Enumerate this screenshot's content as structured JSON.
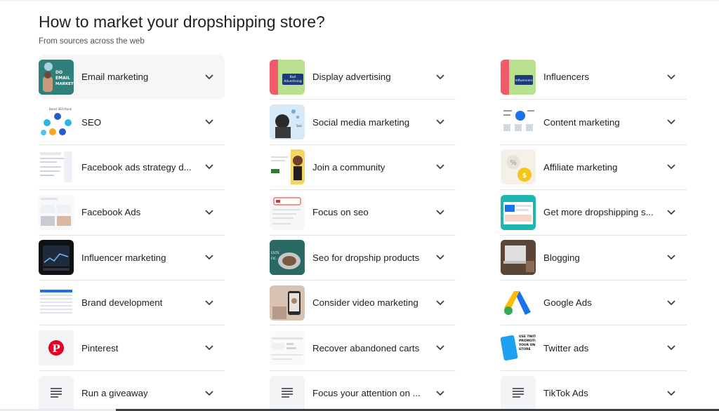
{
  "header": {
    "title": "How to market your dropshipping store?",
    "subtitle": "From sources across the web"
  },
  "icons": {
    "chevron": "chevron-down-icon",
    "doc": "document-lines-icon"
  },
  "colors": {
    "text": "#202124",
    "subtext": "#4d5156",
    "divider": "#e3e3e3",
    "pinterest": "#e60023"
  },
  "columns": [
    {
      "items": [
        {
          "label": "Email marketing",
          "thumb": "email"
        },
        {
          "label": "SEO",
          "thumb": "seo"
        },
        {
          "label": "Facebook ads strategy d...",
          "thumb": "fbstrategy"
        },
        {
          "label": "Facebook Ads",
          "thumb": "fbads"
        },
        {
          "label": "Influencer marketing",
          "thumb": "influencerm"
        },
        {
          "label": "Brand development",
          "thumb": "brand"
        },
        {
          "label": "Pinterest",
          "thumb": "pinterest"
        },
        {
          "label": "Run a giveaway",
          "thumb": "doc"
        }
      ]
    },
    {
      "items": [
        {
          "label": "Display advertising",
          "thumb": "display"
        },
        {
          "label": "Social media marketing",
          "thumb": "social"
        },
        {
          "label": "Join a community",
          "thumb": "community"
        },
        {
          "label": "Focus on seo",
          "thumb": "focusseo"
        },
        {
          "label": "Seo for dropship products",
          "thumb": "seodrop"
        },
        {
          "label": "Consider video marketing",
          "thumb": "video"
        },
        {
          "label": "Recover abandoned carts",
          "thumb": "carts"
        },
        {
          "label": "Focus your attention on ...",
          "thumb": "doc"
        }
      ]
    },
    {
      "items": [
        {
          "label": "Influencers",
          "thumb": "influencers"
        },
        {
          "label": "Content marketing",
          "thumb": "content"
        },
        {
          "label": "Affiliate marketing",
          "thumb": "affiliate"
        },
        {
          "label": "Get more dropshipping s...",
          "thumb": "getmore"
        },
        {
          "label": "Blogging",
          "thumb": "blogging"
        },
        {
          "label": "Google Ads",
          "thumb": "googleads"
        },
        {
          "label": "Twitter ads",
          "thumb": "twitter"
        },
        {
          "label": "TikTok Ads",
          "thumb": "doc"
        }
      ]
    }
  ],
  "thumb_text": {
    "email": "DO EMAIL MARKETI",
    "display": "Bad Advertising",
    "influencers": "Influencers",
    "twitter": "USE TWITT PROMOTI YOUR ON STORE"
  }
}
